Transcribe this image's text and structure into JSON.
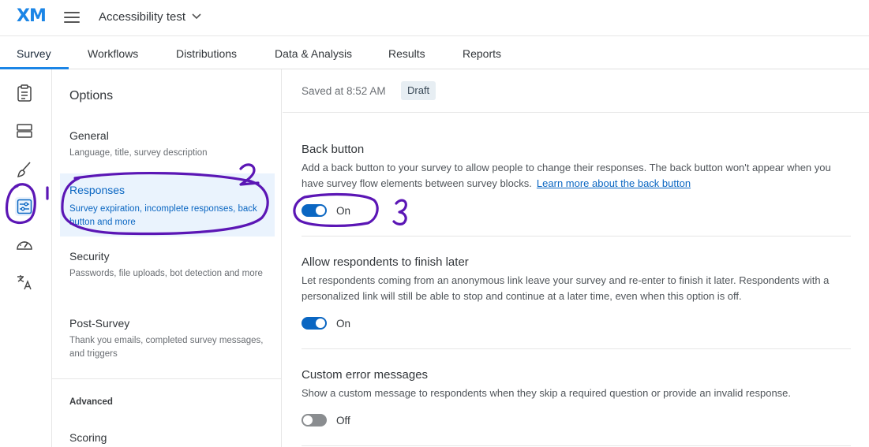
{
  "app": {
    "logo": "XM",
    "project_title": "Accessibility test"
  },
  "nav": {
    "tabs": [
      {
        "label": "Survey",
        "active": true
      },
      {
        "label": "Workflows"
      },
      {
        "label": "Distributions"
      },
      {
        "label": "Data & Analysis"
      },
      {
        "label": "Results"
      },
      {
        "label": "Reports"
      }
    ]
  },
  "rail": {
    "icons": [
      "clipboard-icon",
      "blocks-icon",
      "paintbrush-icon",
      "sliders-icon",
      "gauge-icon",
      "translate-icon"
    ],
    "active": "sliders-icon"
  },
  "options": {
    "title": "Options",
    "items": [
      {
        "label": "General",
        "desc": "Language, title, survey description"
      },
      {
        "label": "Responses",
        "desc": "Survey expiration, incomplete responses, back button and more",
        "active": true
      },
      {
        "label": "Security",
        "desc": "Passwords, file uploads, bot detection and more"
      },
      {
        "label": "Post-Survey",
        "desc": "Thank you emails, completed survey messages, and triggers"
      }
    ],
    "advanced_label": "Advanced",
    "scoring_label": "Scoring"
  },
  "status": {
    "saved": "Saved at 8:52 AM",
    "badge": "Draft"
  },
  "sections": [
    {
      "title": "Back button",
      "desc": "Add a back button to your survey to allow people to change their responses. The back button won't appear when you have survey flow elements between survey blocks.",
      "link": "Learn more about the back button",
      "toggle": "On"
    },
    {
      "title": "Allow respondents to finish later",
      "desc": "Let respondents coming from an anonymous link leave your survey and re-enter to finish it later. Respondents with a personalized link will still be able to stop and continue at a later time, even when this option is off.",
      "toggle": "On"
    },
    {
      "title": "Custom error messages",
      "desc": "Show a custom message to respondents when they skip a required question or provide an invalid response.",
      "toggle": "Off"
    }
  ],
  "annotations": {
    "color": "#5b16b5",
    "numbers": [
      "1",
      "2",
      "3"
    ]
  },
  "colors": {
    "accent": "#0a66c2",
    "brand": "#1b85e6",
    "annotation": "#5b16b5"
  }
}
